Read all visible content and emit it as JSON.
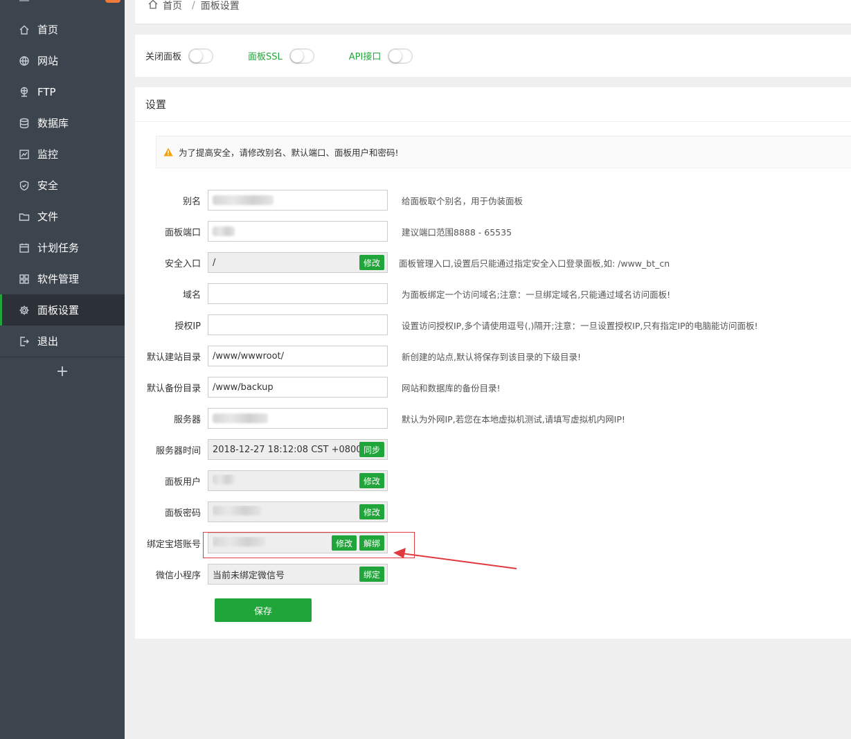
{
  "sidebar": {
    "items": [
      {
        "label": "首页",
        "icon": "home-icon"
      },
      {
        "label": "网站",
        "icon": "globe-icon"
      },
      {
        "label": "FTP",
        "icon": "ftp-icon"
      },
      {
        "label": "数据库",
        "icon": "database-icon"
      },
      {
        "label": "监控",
        "icon": "monitor-icon"
      },
      {
        "label": "安全",
        "icon": "shield-icon"
      },
      {
        "label": "文件",
        "icon": "folder-icon"
      },
      {
        "label": "计划任务",
        "icon": "calendar-icon"
      },
      {
        "label": "软件管理",
        "icon": "grid-icon"
      },
      {
        "label": "面板设置",
        "icon": "gear-icon"
      },
      {
        "label": "退出",
        "icon": "logout-icon"
      }
    ],
    "active_index": 9,
    "add_label": "+"
  },
  "breadcrumb": {
    "home": "首页",
    "separator": "/",
    "current": "面板设置"
  },
  "toggles": {
    "close_panel": "关闭面板",
    "panel_ssl": "面板SSL",
    "api": "API接口"
  },
  "panel": {
    "title": "设置",
    "alert": "为了提高安全，请修改别名、默认端口、面板用户和密码!",
    "save_label": "保存"
  },
  "form": {
    "alias": {
      "label": "别名",
      "hint": "给面板取个别名，用于伪装面板"
    },
    "port": {
      "label": "面板端口",
      "hint": "建议端口范围8888 - 65535"
    },
    "entry": {
      "label": "安全入口",
      "value": "/",
      "button": "修改",
      "hint": "面板管理入口,设置后只能通过指定安全入口登录面板,如: /www_bt_cn"
    },
    "domain": {
      "label": "域名",
      "value": "",
      "hint": "为面板绑定一个访问域名;注意：一旦绑定域名,只能通过域名访问面板!"
    },
    "auth_ip": {
      "label": "授权IP",
      "value": "",
      "hint": "设置访问授权IP,多个请使用逗号(,)隔开;注意：一旦设置授权IP,只有指定IP的电脑能访问面板!"
    },
    "site_dir": {
      "label": "默认建站目录",
      "value": "/www/wwwroot/",
      "hint": "新创建的站点,默认将保存到该目录的下级目录!"
    },
    "backup_dir": {
      "label": "默认备份目录",
      "value": "/www/backup",
      "hint": "网站和数据库的备份目录!"
    },
    "server_ip": {
      "label": "服务器",
      "hint": "默认为外网IP,若您在本地虚拟机测试,请填写虚拟机内网IP!"
    },
    "server_time": {
      "label": "服务器时间",
      "value": "2018-12-27 18:12:08 CST +0800",
      "button": "同步"
    },
    "panel_user": {
      "label": "面板用户",
      "button": "修改"
    },
    "panel_password": {
      "label": "面板密码",
      "button": "修改"
    },
    "bt_account": {
      "label": "绑定宝塔账号",
      "button_edit": "修改",
      "button_unbind": "解绑"
    },
    "wechat": {
      "label": "微信小程序",
      "value": "当前未绑定微信号",
      "button": "绑定"
    }
  },
  "colors": {
    "sidebar_bg": "#3c444d",
    "accent": "#20a53a",
    "annotation": "#e0393e",
    "warning": "#f0a30a"
  }
}
